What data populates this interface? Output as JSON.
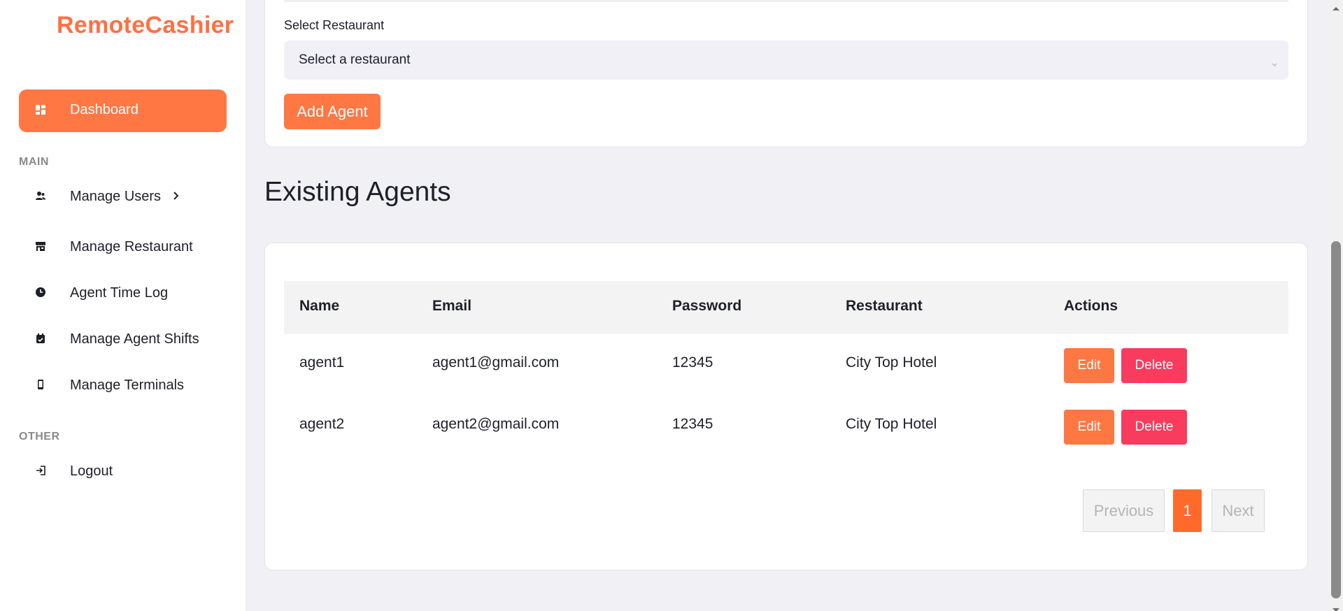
{
  "brand": "RemoteCashier",
  "sidebar": {
    "active_item": {
      "label": "Dashboard",
      "icon": "dashboard-icon"
    },
    "sections": [
      {
        "label": "MAIN"
      },
      {
        "label": "OTHER"
      }
    ],
    "items": [
      {
        "label": "Manage Users",
        "icon": "users-icon",
        "has_chevron": true
      },
      {
        "label": "Manage Restaurant",
        "icon": "store-icon"
      },
      {
        "label": "Agent Time Log",
        "icon": "clock-icon"
      },
      {
        "label": "Manage Agent Shifts",
        "icon": "calendar-check-icon"
      },
      {
        "label": "Manage Terminals",
        "icon": "mobile-icon"
      },
      {
        "label": "Logout",
        "icon": "logout-icon"
      }
    ]
  },
  "form": {
    "restaurant_label": "Select Restaurant",
    "restaurant_select_value": "Select a restaurant",
    "add_button": "Add Agent"
  },
  "agents": {
    "heading": "Existing Agents",
    "columns": [
      "Name",
      "Email",
      "Password",
      "Restaurant",
      "Actions"
    ],
    "rows": [
      {
        "name": "agent1",
        "email": "agent1@gmail.com",
        "password": "12345",
        "restaurant": "City Top Hotel"
      },
      {
        "name": "agent2",
        "email": "agent2@gmail.com",
        "password": "12345",
        "restaurant": "City Top Hotel"
      }
    ],
    "edit_label": "Edit",
    "delete_label": "Delete",
    "pagination": {
      "previous": "Previous",
      "current": "1",
      "next": "Next"
    }
  },
  "colors": {
    "accent": "#ff7743",
    "danger": "#f93b5e",
    "background": "#f0f0f5"
  }
}
